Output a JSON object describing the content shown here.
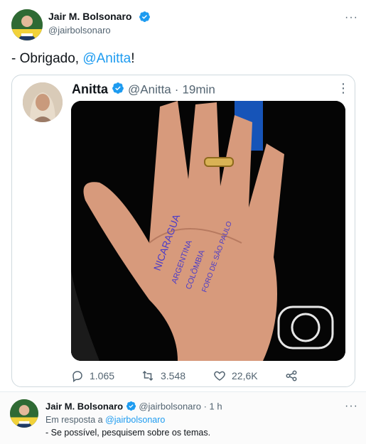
{
  "tweet": {
    "author_name": "Jair M. Bolsonaro",
    "author_handle": "@jairbolsonaro",
    "text_prefix": "- Obrigado, ",
    "text_mention": "@Anitta",
    "text_suffix": "!",
    "more_label": "···"
  },
  "quoted": {
    "author_name": "Anitta",
    "author_handle": "@Anitta",
    "separator": "·",
    "time": "19min",
    "more_label": "⋮",
    "hand_words": [
      "NICARAGUA",
      "ARGENTINA",
      "COLÔMBIA",
      "FORO DE SÃO PAULO"
    ]
  },
  "actions": {
    "replies": "1.065",
    "retweets": "3.548",
    "likes": "22,6K"
  },
  "reply": {
    "author_name": "Jair M. Bolsonaro",
    "author_handle": "@jairbolsonaro",
    "time": "· 1 h",
    "more_label": "···",
    "in_reply_prefix": "Em resposta a ",
    "in_reply_handle": "@jairbolsonaro",
    "text": "- Se possível, pesquisem sobre os temas."
  },
  "colors": {
    "accent": "#1d9bf0",
    "muted": "#536471",
    "text": "#0f1419"
  },
  "icons": [
    "verified-badge-icon",
    "more-icon",
    "reply-icon",
    "retweet-icon",
    "like-icon",
    "share-icon"
  ]
}
